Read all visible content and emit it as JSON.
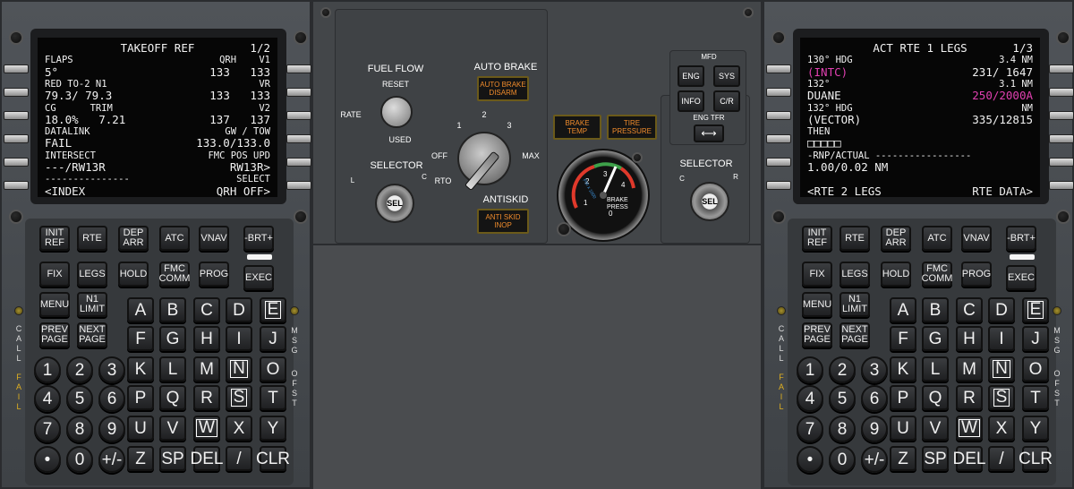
{
  "left_cdu": {
    "lines": [
      {
        "l": "",
        "c": "TAKEOFF REF",
        "r": "1/2"
      },
      {
        "l": "FLAPS",
        "c": "",
        "r": "QRH    V1",
        "small": true
      },
      {
        "l": "5°",
        "c": "",
        "r": "133   133"
      },
      {
        "l": "RED TO-2 N1",
        "c": "",
        "r": "VR",
        "small": true
      },
      {
        "l": "79.3/ 79.3",
        "c": "",
        "r": "133   133"
      },
      {
        "l": "CG      TRIM",
        "c": "",
        "r": "V2",
        "small": true
      },
      {
        "l": "18.0%   7.21",
        "c": "",
        "r": "137   137"
      },
      {
        "l": "DATALINK",
        "c": "",
        "r": "GW / TOW",
        "small": true
      },
      {
        "l": "FAIL",
        "c": "",
        "r": "133.0/133.0"
      },
      {
        "l": "INTERSECT",
        "c": "",
        "r": "FMC POS UPD",
        "small": true
      },
      {
        "l": "---/RW13R",
        "c": "",
        "r": "RW13R>"
      },
      {
        "l": "---------------",
        "c": "",
        "r": "SELECT",
        "small": true
      },
      {
        "l": "<INDEX",
        "c": "",
        "r": "QRH OFF>"
      }
    ]
  },
  "right_cdu": {
    "lines": [
      {
        "l": "",
        "c": "ACT RTE 1 LEGS",
        "r": "1/3"
      },
      {
        "l": "130° HDG",
        "c": "",
        "r": "3.4 NM",
        "small": true
      },
      {
        "l": "(INTC)",
        "c": "",
        "r": "231/ 1647",
        "lmag": true
      },
      {
        "l": "132°",
        "c": "",
        "r": "3.1 NM",
        "small": true
      },
      {
        "l": "DUANE",
        "c": "",
        "r": "250/2000A",
        "rmag": true
      },
      {
        "l": "132° HDG",
        "c": "",
        "r": "NM",
        "small": true
      },
      {
        "l": "(VECTOR)",
        "c": "",
        "r": "335/12815"
      },
      {
        "l": "THEN",
        "c": "",
        "r": "",
        "small": true
      },
      {
        "l": "□□□□□",
        "c": "",
        "r": ""
      },
      {
        "l": "-RNP/ACTUAL -----------------",
        "c": "",
        "r": "",
        "small": true
      },
      {
        "l": "1.00/0.02 NM",
        "c": "",
        "r": ""
      },
      {
        "l": "",
        "c": "",
        "r": "",
        "small": true
      },
      {
        "l": "<RTE 2 LEGS",
        "c": "",
        "r": "RTE DATA>"
      }
    ]
  },
  "keys": {
    "func": [
      "INIT\nREF",
      "RTE",
      "DEP\nARR",
      "ATC",
      "VNAV",
      "FIX",
      "LEGS",
      "HOLD",
      "FMC\nCOMM",
      "PROG",
      "MENU",
      "N1\nLIMIT",
      "PREV\nPAGE",
      "NEXT\nPAGE"
    ],
    "brt": "-BRT+",
    "exec": "EXEC",
    "letters": [
      "A",
      "B",
      "C",
      "D",
      "E",
      "F",
      "G",
      "H",
      "I",
      "J",
      "K",
      "L",
      "M",
      "N",
      "O",
      "P",
      "Q",
      "R",
      "S",
      "T",
      "U",
      "V",
      "W",
      "X",
      "Y",
      "Z",
      "SP",
      "DEL",
      "/",
      "CLR"
    ],
    "boxed": [
      "E",
      "N",
      "S",
      "W"
    ],
    "digits": [
      "1",
      "2",
      "3",
      "4",
      "5",
      "6",
      "7",
      "8",
      "9",
      "•",
      "0",
      "+/-"
    ],
    "call": "CALL",
    "fail": "FAIL",
    "msg": "MSG",
    "ofst": "OFST"
  },
  "center": {
    "fuel_flow": "FUEL FLOW",
    "reset": "RESET",
    "rate": "RATE",
    "used": "USED",
    "selector": "SELECTOR",
    "sel": "SEL",
    "l": "L",
    "c": "C",
    "r": "R",
    "auto_brake": "AUTO BRAKE",
    "auto_brake_disarm": "AUTO BRAKE\nDISARM",
    "ab_settings": [
      "RTO",
      "OFF",
      "1",
      "2",
      "3",
      "MAX"
    ],
    "antiskid": "ANTISKID",
    "antiskid_inop": "ANTI SKID\nINOP",
    "brake_temp": "BRAKE\nTEMP",
    "tire_pressure": "TIRE\nPRESSURE",
    "brake_press": "BRAKE\nPRESS",
    "psi": "PSI x 1000",
    "gauge_ticks": [
      "0",
      "1",
      "2",
      "3",
      "4"
    ],
    "mfd": "MFD",
    "mfd_keys": [
      "ENG",
      "SYS",
      "INFO",
      "C/R"
    ],
    "eng_tfr": "ENG TFR",
    "tfr_arrow": "⟷"
  },
  "colors": {
    "screen_text": "#f2f2f2",
    "magenta": "#e040b0",
    "annunciator": "#ef8b2c"
  }
}
